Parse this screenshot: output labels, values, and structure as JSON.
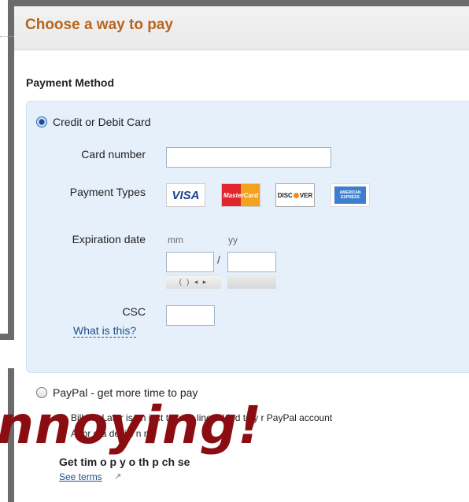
{
  "header": {
    "title": "Choose a way to pay"
  },
  "payment_method": {
    "section_label": "Payment Method",
    "credit_card": {
      "label": "Credit or Debit Card",
      "selected": true,
      "card_number_label": "Card number",
      "card_number_value": "",
      "payment_types_label": "Payment Types",
      "payment_types": [
        {
          "name": "VISA",
          "icon": "visa-logo-icon"
        },
        {
          "name": "MasterCard",
          "icon": "mastercard-logo-icon"
        },
        {
          "name": "DISC",
          "name2": "VER",
          "icon": "discover-logo-icon"
        },
        {
          "name": "AMERICAN EXPRESS",
          "icon": "amex-logo-icon"
        }
      ],
      "expiration_label": "Expiration date",
      "expiration_mm_label": "mm",
      "expiration_yy_label": "yy",
      "expiration_separator": "/",
      "csc_label": "CSC",
      "csc_help_link": "What is this?"
    },
    "paypal": {
      "label": "PayPal - get more time to pay",
      "selected": false,
      "bullets": [
        "Bill Me Later is an inst    t credit line added to y    r PayPal account",
        "Appr     g    a decisi    n    nd"
      ],
      "bold_line": "Get      tim    o p   y o    th    p    ch   se",
      "terms_link": "See terms"
    }
  },
  "overlay_text": "nnoying!",
  "colors": {
    "title": "#b8651c",
    "panel_bg": "#e6f0fa",
    "link": "#1d4f8c",
    "overlay": "#8b0d12"
  }
}
